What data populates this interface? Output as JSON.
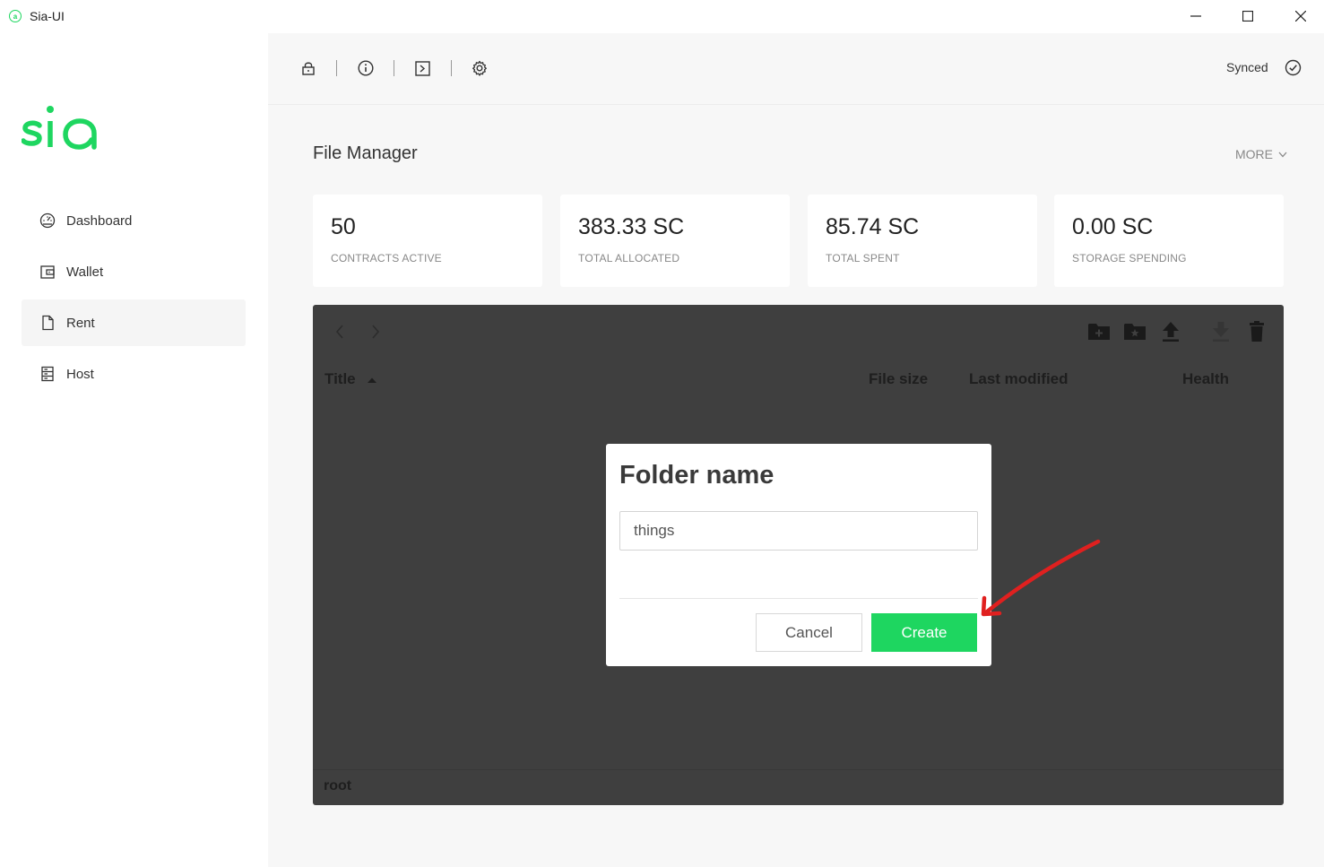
{
  "window": {
    "title": "Sia-UI",
    "app_icon": "sia-app-icon"
  },
  "sidebar": {
    "logo_text": "sia",
    "items": [
      {
        "label": "Dashboard",
        "icon": "dashboard-icon",
        "active": false
      },
      {
        "label": "Wallet",
        "icon": "wallet-icon",
        "active": false
      },
      {
        "label": "Rent",
        "icon": "file-icon",
        "active": true
      },
      {
        "label": "Host",
        "icon": "server-icon",
        "active": false
      }
    ]
  },
  "toolbar": {
    "icons": [
      "lock-icon",
      "info-icon",
      "terminal-icon",
      "gear-icon"
    ],
    "status_label": "Synced"
  },
  "page": {
    "title": "File Manager",
    "more_label": "MORE"
  },
  "stats": [
    {
      "value": "50",
      "label": "CONTRACTS ACTIVE"
    },
    {
      "value": "383.33 SC",
      "label": "TOTAL ALLOCATED"
    },
    {
      "value": "85.74 SC",
      "label": "TOTAL SPENT"
    },
    {
      "value": "0.00 SC",
      "label": "STORAGE SPENDING"
    }
  ],
  "file_browser": {
    "columns": {
      "title": "Title",
      "file_size": "File size",
      "last_modified": "Last modified",
      "health": "Health"
    },
    "path": "root",
    "actions": [
      "new-folder-icon",
      "add-folder-icon",
      "upload-icon",
      "download-icon",
      "trash-icon"
    ]
  },
  "dialog": {
    "title": "Folder name",
    "input_value": "things",
    "cancel_label": "Cancel",
    "create_label": "Create"
  },
  "colors": {
    "accent": "#1ed660",
    "annotation": "#e0201f",
    "browser_bg": "#3f3f3f"
  }
}
